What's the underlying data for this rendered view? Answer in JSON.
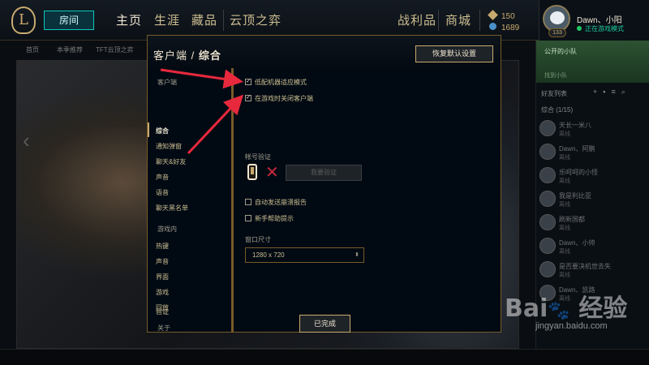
{
  "topbar": {
    "play_label": "房间",
    "nav": [
      "主页",
      "生涯",
      "藏品",
      "云顶之弈",
      "战利品",
      "商城"
    ],
    "currency": {
      "blue_essence": "150",
      "rp": "1689"
    }
  },
  "profile": {
    "name": "Dawn、小阳",
    "status": "正在游戏模式",
    "level": "133"
  },
  "subnav": [
    "首页",
    "本季推荐",
    "TFT云顶之弈"
  ],
  "social": {
    "club_title": "公开的小队",
    "club_sub": "找到小队",
    "friends_header": "好友列表",
    "group": "综合 (1/15)",
    "friends": [
      {
        "name": "天长一米八",
        "status": "离线"
      },
      {
        "name": "Dawn、阿鹏",
        "status": "离线"
      },
      {
        "name": "乐呵呵的小怪",
        "status": "离线"
      },
      {
        "name": "我是利比亚",
        "status": "离线"
      },
      {
        "name": "刷新国都",
        "status": "离线"
      },
      {
        "name": "Dawn、小帅",
        "status": "离线"
      },
      {
        "name": "是否要决机世去失",
        "status": "离线"
      },
      {
        "name": "Dawn、凯路",
        "status": "离线"
      }
    ]
  },
  "dialog": {
    "title_prefix": "客户端",
    "title_sep": "/",
    "title_current": "综合",
    "reset_label": "恢复默认设置",
    "done_label": "已完成",
    "nav": {
      "client_section": "客户端",
      "client_items": [
        "综合",
        "通知弹窗",
        "聊天&好友",
        "声音",
        "语音",
        "聊天黑名单"
      ],
      "ingame_section": "游戏内",
      "ingame_items": [
        "热键",
        "声音",
        "界面",
        "游戏",
        "回放"
      ],
      "about_section": "关于",
      "about_items": [
        "验证"
      ]
    },
    "options": {
      "low_spec": {
        "label": "低配机器适应模式",
        "checked": true
      },
      "close_client": {
        "label": "在游戏时关闭客户端",
        "checked": true
      },
      "account_verify_label": "帐号验证",
      "verify_button": "我要验证",
      "auto_report": {
        "label": "自动发送崩溃报告",
        "checked": false
      },
      "tutorial": {
        "label": "新手帮助提示",
        "checked": false
      },
      "window_size_label": "窗口尺寸",
      "window_size_value": "1280 x 720"
    }
  },
  "watermark": {
    "logo": "Bai百 经验",
    "url": "jingyan.baidu.com"
  },
  "colors": {
    "gold": "#c8aa6e",
    "teal": "#0ac8b9",
    "annotation_red": "#e8283c"
  }
}
